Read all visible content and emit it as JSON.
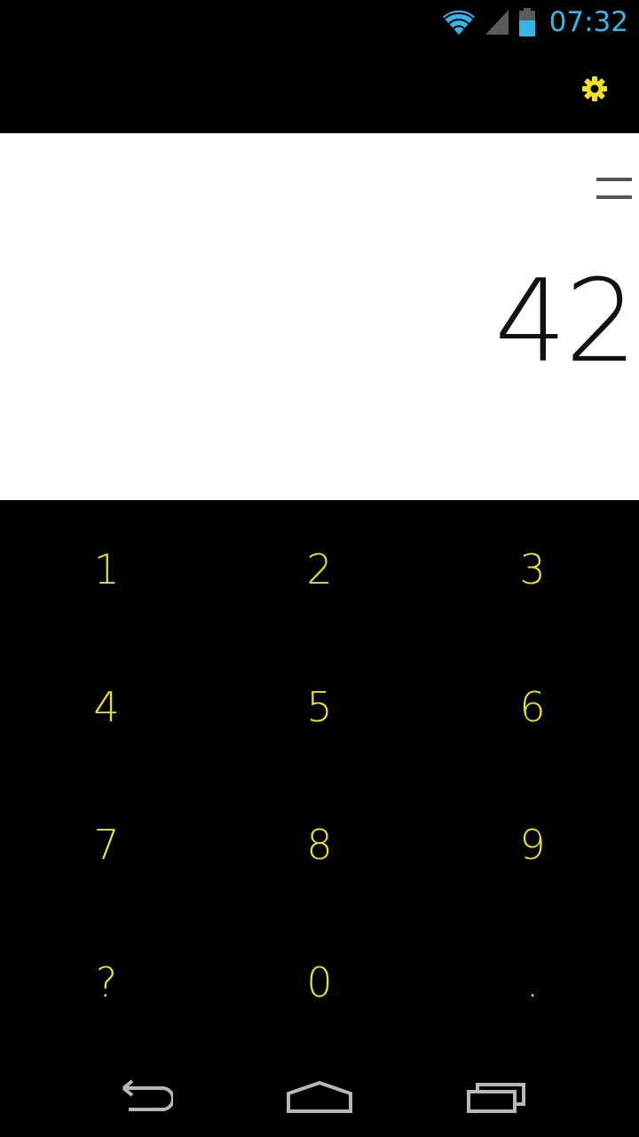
{
  "status_bar": {
    "time": "07:32",
    "icons": [
      "wifi-icon",
      "cell-signal-icon",
      "battery-icon"
    ],
    "time_color": "#33b5e5"
  },
  "action_bar": {
    "settings_icon": "gear-icon",
    "settings_color": "#f0e020"
  },
  "display": {
    "result": "42",
    "menu_icon": "menu-lines-icon"
  },
  "keypad": {
    "text_color": "#e8e030",
    "keys": [
      {
        "label": "1",
        "name": "key-1"
      },
      {
        "label": "2",
        "name": "key-2"
      },
      {
        "label": "3",
        "name": "key-3"
      },
      {
        "label": "4",
        "name": "key-4"
      },
      {
        "label": "5",
        "name": "key-5"
      },
      {
        "label": "6",
        "name": "key-6"
      },
      {
        "label": "7",
        "name": "key-7"
      },
      {
        "label": "8",
        "name": "key-8"
      },
      {
        "label": "9",
        "name": "key-9"
      },
      {
        "label": "?",
        "name": "key-question"
      },
      {
        "label": "0",
        "name": "key-0"
      },
      {
        "label": ".",
        "name": "key-decimal"
      }
    ]
  },
  "nav_bar": {
    "buttons": [
      "back-icon",
      "home-icon",
      "recent-apps-icon"
    ]
  }
}
